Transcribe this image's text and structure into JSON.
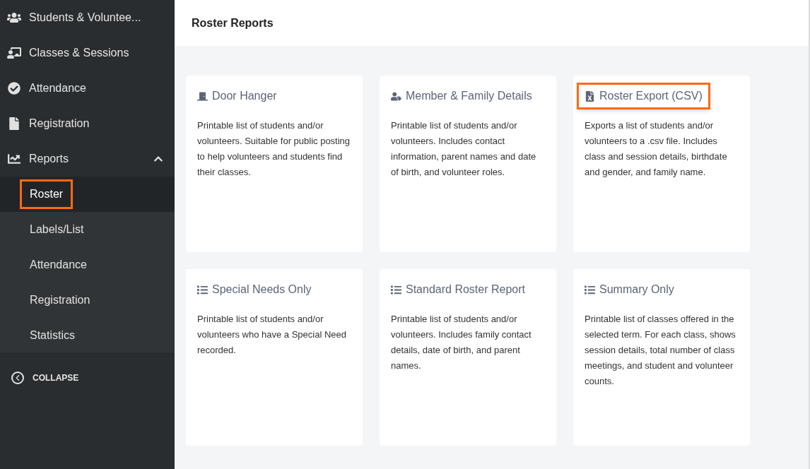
{
  "sidebar": {
    "items": [
      {
        "label": "Students & Voluntee..."
      },
      {
        "label": "Classes & Sessions"
      },
      {
        "label": "Attendance"
      },
      {
        "label": "Registration"
      },
      {
        "label": "Reports",
        "expanded": true,
        "children": [
          {
            "label": "Roster",
            "selected": true,
            "highlighted": true
          },
          {
            "label": "Labels/List",
            "selected": false,
            "highlighted": false
          },
          {
            "label": "Attendance",
            "selected": false,
            "highlighted": false
          },
          {
            "label": "Registration",
            "selected": false,
            "highlighted": false
          },
          {
            "label": "Statistics",
            "selected": false,
            "highlighted": false
          }
        ]
      }
    ],
    "collapse": "COLLAPSE"
  },
  "header": {
    "title": "Roster Reports"
  },
  "reports": [
    {
      "title": "Door Hanger",
      "highlighted": false,
      "description": "Printable list of students and/or volunteers. Suitable for public posting to help volunteers and students find their classes."
    },
    {
      "title": "Member & Family Details",
      "highlighted": false,
      "description": "Printable list of students and/or volunteers. Includes contact information, parent names and date of birth, and volunteer roles."
    },
    {
      "title": "Roster Export (CSV)",
      "highlighted": true,
      "description": "Exports a list of students and/or volunteers to a .csv file. Includes class and session details, birthdate and gender, and family name."
    },
    {
      "title": "Special Needs Only",
      "highlighted": false,
      "description": "Printable list of students and/or volunteers who have a Special Need recorded."
    },
    {
      "title": "Standard Roster Report",
      "highlighted": false,
      "description": "Printable list of students and/or volunteers. Includes family contact details, date of birth, and parent names."
    },
    {
      "title": "Summary Only",
      "highlighted": false,
      "description": "Printable list of classes offered in the selected term. For each class, shows session details, total number of class meetings, and student and volunteer counts."
    }
  ]
}
